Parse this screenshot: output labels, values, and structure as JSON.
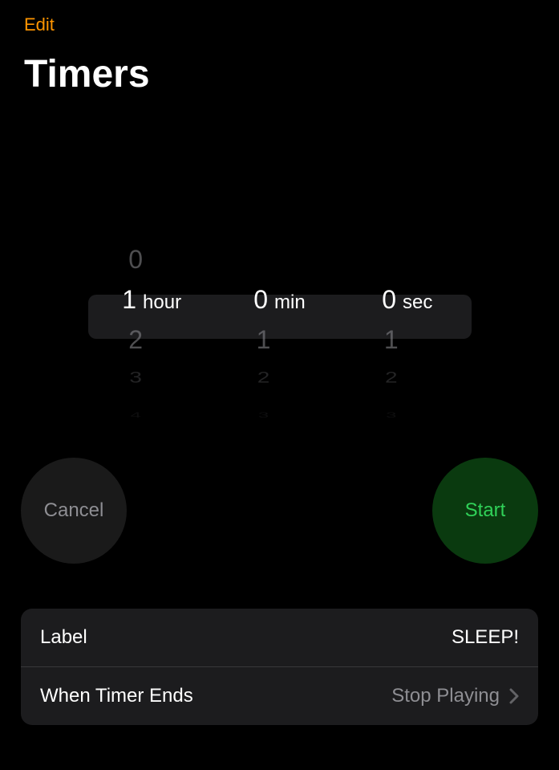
{
  "header": {
    "edit": "Edit",
    "title": "Timers"
  },
  "picker": {
    "hours": {
      "above": [
        "0"
      ],
      "selected": "1",
      "unit": "hour",
      "below": [
        "2",
        "3",
        "4"
      ]
    },
    "minutes": {
      "above": [],
      "selected": "0",
      "unit": "min",
      "below": [
        "1",
        "2",
        "3"
      ]
    },
    "seconds": {
      "above": [],
      "selected": "0",
      "unit": "sec",
      "below": [
        "1",
        "2",
        "3"
      ]
    }
  },
  "buttons": {
    "cancel": "Cancel",
    "start": "Start"
  },
  "settings": {
    "label_row": {
      "title": "Label",
      "value": "SLEEP!"
    },
    "end_row": {
      "title": "When Timer Ends",
      "value": "Stop Playing"
    }
  }
}
